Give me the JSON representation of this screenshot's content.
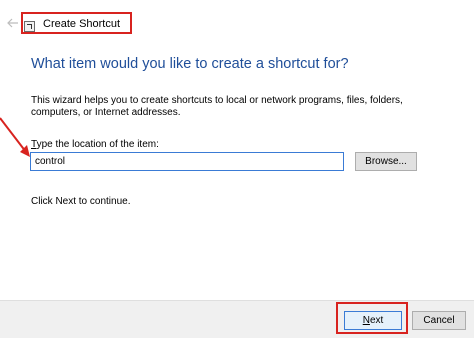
{
  "window": {
    "title": "Create Shortcut",
    "back_icon": "back-arrow-icon",
    "title_icon": "shortcut-icon"
  },
  "content": {
    "heading": "What item would you like to create a shortcut for?",
    "description": "This wizard helps you to create shortcuts to local or network programs, files, folders, computers, or Internet addresses.",
    "field_label_mnemonic": "T",
    "field_label_rest": "ype the location of the item:",
    "input_value": "control",
    "browse_label": "Browse...",
    "continue_text": "Click Next to continue."
  },
  "footer": {
    "next_mnemonic": "N",
    "next_rest": "ext",
    "cancel_label": "Cancel"
  },
  "annotation": {
    "highlight_color": "#d8231f",
    "arrow_color": "#d8231f"
  }
}
